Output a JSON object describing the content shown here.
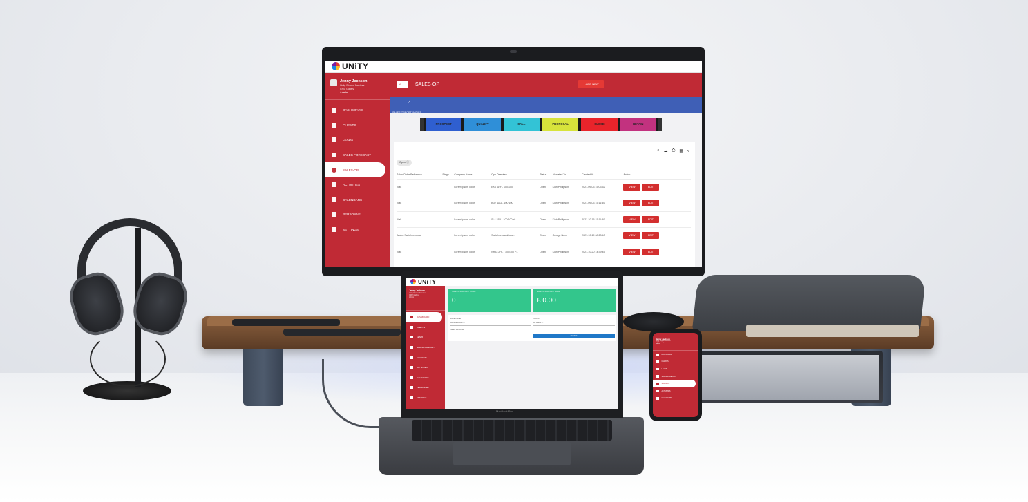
{
  "brand": {
    "logo_text": "UNiTY"
  },
  "user": {
    "name": "Jenny Jackson",
    "line1": "Unity Shared Services",
    "line2": "CRM Gallery",
    "role": "Admin"
  },
  "monitor": {
    "nav": [
      {
        "label": "DASHBOARD",
        "icon": "dashboard-icon"
      },
      {
        "label": "CLIENTS",
        "icon": "clients-icon"
      },
      {
        "label": "LEADS",
        "icon": "leads-icon"
      },
      {
        "label": "SALES FORECAST",
        "icon": "trend-icon"
      },
      {
        "label": "SALES-OP",
        "icon": "target-icon",
        "active": true
      },
      {
        "label": "ACTIVITIES",
        "icon": "phone-icon"
      },
      {
        "label": "CALENDARS",
        "icon": "calendar-icon"
      },
      {
        "label": "PERSONNEL",
        "icon": "person-icon"
      },
      {
        "label": "SETTINGS",
        "icon": "gear-icon"
      }
    ],
    "page_title": "SALES-OP",
    "back_label": "⟵",
    "add_new_label": "+ ADD NEW",
    "banner_check": "✓",
    "banner_label": "SALES OPPORTUNITIES",
    "pipeline": [
      {
        "label": "PROSPECT",
        "color": "#2f5fd0"
      },
      {
        "label": "QUALIFY",
        "color": "#2f8fd8"
      },
      {
        "label": "CALL",
        "color": "#33c3d6"
      },
      {
        "label": "PROPOSAL",
        "color": "#d7e33b"
      },
      {
        "label": "CLOSE",
        "color": "#e8242b"
      },
      {
        "label": "RETAIN",
        "color": "#c2327f"
      }
    ],
    "toolbar_icons": [
      "search-icon",
      "cloud-icon",
      "print-icon",
      "columns-icon",
      "filter-icon"
    ],
    "filter_chip": "Open ⓧ",
    "table": {
      "headers": [
        "Sales Order Reference",
        "Stage",
        "Company Name",
        "Opp Overview",
        "Status",
        "Allocated To",
        "Created At",
        "Action"
      ],
      "rows": [
        [
          "Kiah",
          "",
          "Lorem ipsum dolor",
          "EX6 4DY - 100/100",
          "Open",
          "Kiah Phillipson",
          "2021-09-03 15:03:52"
        ],
        [
          "Kiah",
          "",
          "Lorem ipsum dolor",
          "BD7 1AG - 100/100",
          "Open",
          "Kiah Phillipson",
          "2021-09-03 15:11:40"
        ],
        [
          "Kiah",
          "",
          "Lorem ipsum dolor",
          "SL4 1PX - 100/100 sit...",
          "Open",
          "Kiah Phillipson",
          "2021-10-15 15:11:40"
        ],
        [
          "Aratos Switch renewal",
          "",
          "Lorem ipsum dolor",
          "Switch renewal to at...",
          "Open",
          "George Nunn",
          "2021-10-19 08:23:40"
        ],
        [
          "Kiah",
          "",
          "Lorem ipsum dolor",
          "NR33 2HL - 100/100 P...",
          "Open",
          "Kiah Phillipson",
          "2021-10-20 14:39:45"
        ]
      ],
      "view_label": "VIEW",
      "edit_label": "EDIT"
    }
  },
  "laptop": {
    "nav": [
      "DASHBOARD",
      "CLIENTS",
      "LEADS",
      "SALES FORECAST",
      "SALES-OP",
      "ACTIVITIES",
      "CALENDARS",
      "PERSONNEL",
      "SETTINGS"
    ],
    "stat1_caption": "SALES OPPORTUNITY COUNT",
    "stat1_value": "0",
    "stat2_caption": "SALES OPPORTUNITY VALUE",
    "stat2_value": "£ 0.00",
    "filter1_label": "DATE FILTER",
    "filter1_value": "All Time Range ---",
    "filter2_label": "STATUS",
    "filter2_value": "All Status ---",
    "filter3_label": "Select Personnel",
    "search_label": "SEARCH",
    "model_label": "MacBook Pro"
  },
  "phone": {
    "nav": [
      "DASHBOARD",
      "CLIENTS",
      "LEADS",
      "SALES FORECAST",
      "SALES-OP",
      "ACTIVITIES",
      "CALENDARS"
    ],
    "active_index": 4
  }
}
